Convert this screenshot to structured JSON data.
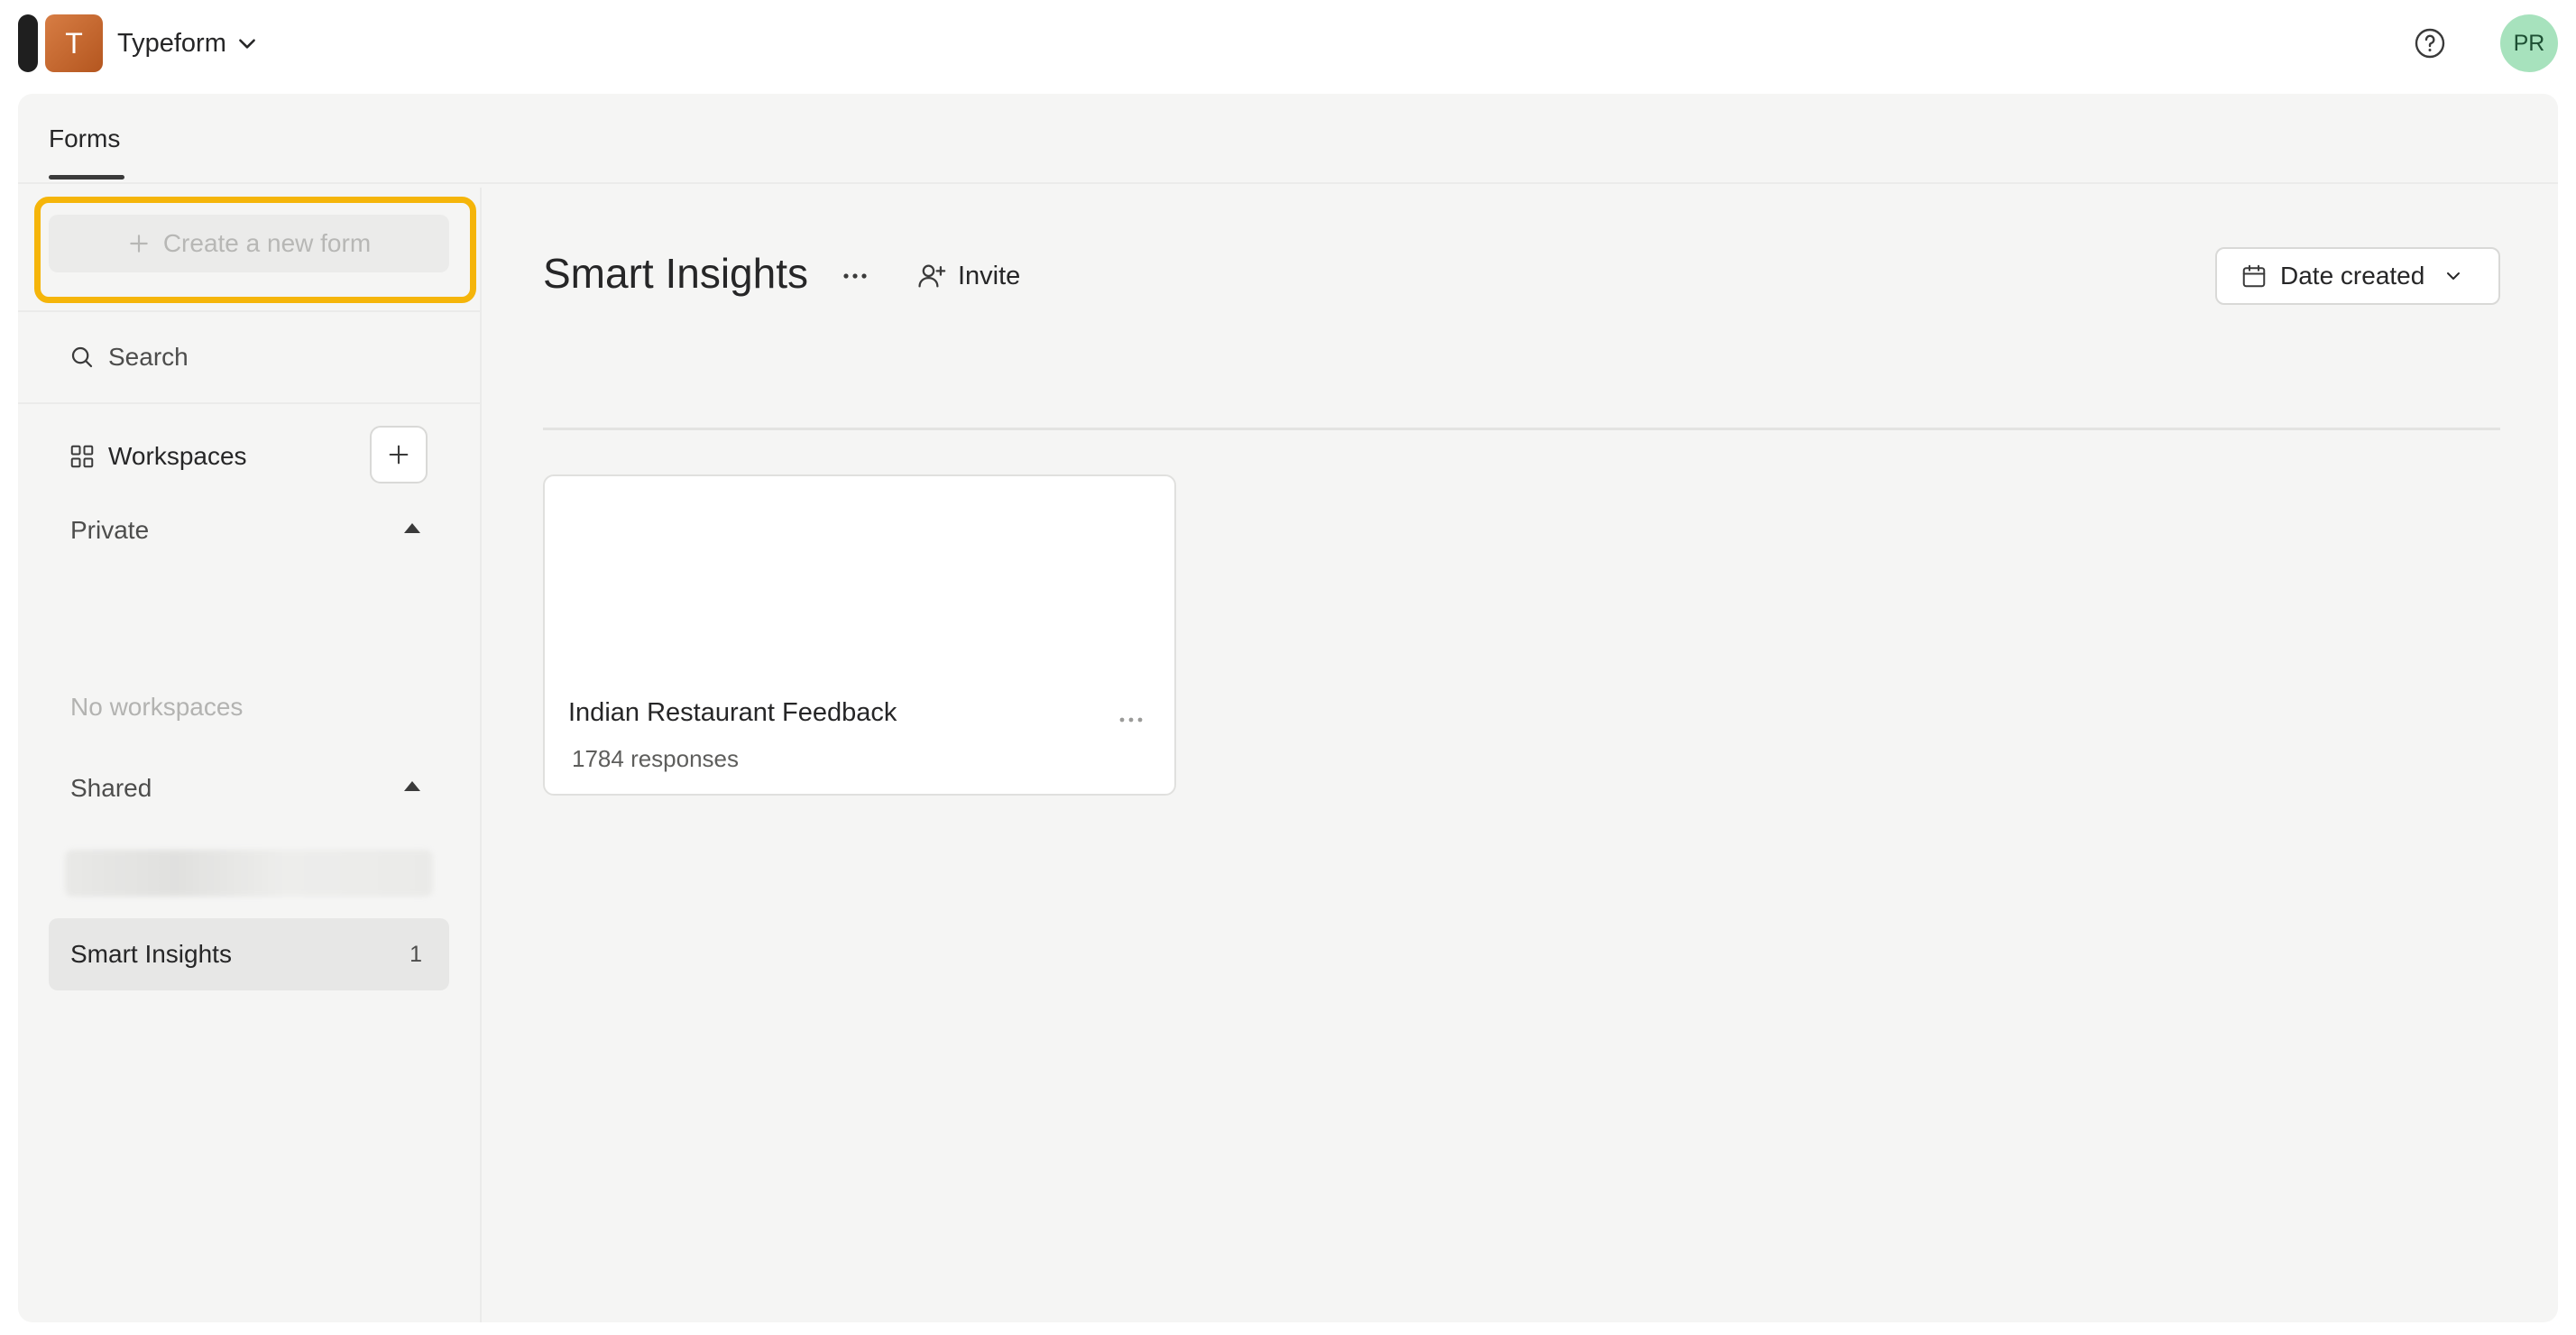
{
  "topbar": {
    "logo_letter": "T",
    "org_name": "Typeform",
    "avatar_initials": "PR"
  },
  "tabs": {
    "forms_label": "Forms"
  },
  "sidebar": {
    "create_label": "Create a new form",
    "search_label": "Search",
    "workspaces_label": "Workspaces",
    "private_label": "Private",
    "private_empty": "No workspaces",
    "shared_label": "Shared",
    "items": [
      {
        "label": "Smart Insights",
        "count": "1"
      }
    ]
  },
  "main": {
    "title": "Smart Insights",
    "invite_label": "Invite",
    "sort_label": "Date created",
    "forms": [
      {
        "title": "Indian Restaurant Feedback",
        "responses": "1784 responses"
      }
    ]
  },
  "colors": {
    "highlight": "#f5b50a",
    "avatar_bg": "#a7e2bd",
    "logo": "#c3672f"
  }
}
